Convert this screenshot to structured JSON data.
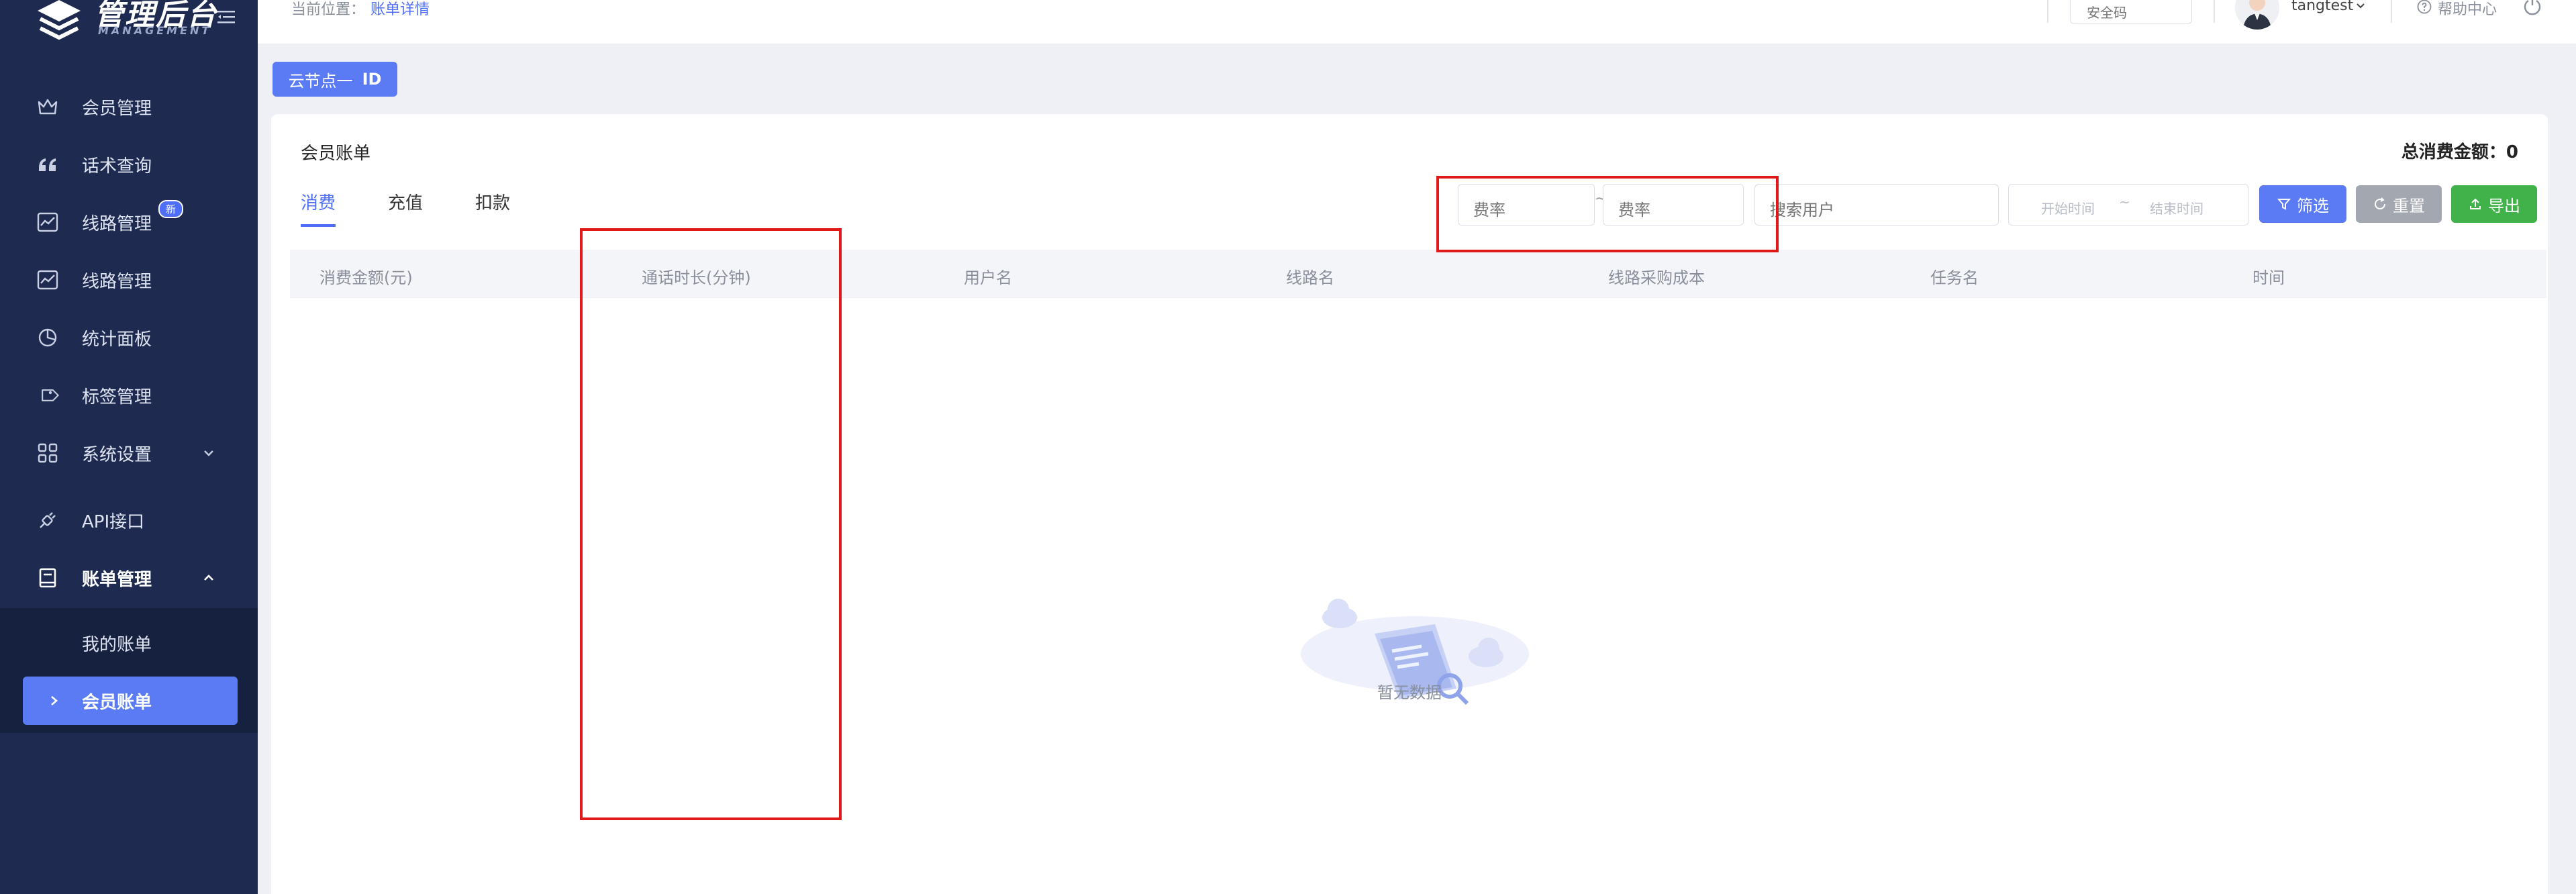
{
  "sidebar": {
    "logo_title": "管理后台",
    "logo_subtitle": "MANAGEMENT",
    "menu": [
      {
        "label": "会员管理",
        "icon": "crown-icon"
      },
      {
        "label": "话术查询",
        "icon": "quote-icon"
      },
      {
        "label": "线路管理",
        "icon": "line-chart-icon",
        "badge": "新"
      },
      {
        "label": "线路管理",
        "icon": "line-chart-icon"
      },
      {
        "label": "统计面板",
        "icon": "pie-chart-icon"
      },
      {
        "label": "标签管理",
        "icon": "tag-icon"
      },
      {
        "label": "系统设置",
        "icon": "grid-icon"
      },
      {
        "label": "API接口",
        "icon": "plug-icon"
      },
      {
        "label": "账单管理",
        "icon": "book-icon"
      }
    ],
    "submenu": [
      {
        "label": "我的账单"
      },
      {
        "label": "会员账单",
        "active": true
      }
    ]
  },
  "header": {
    "breadcrumb_prefix": "当前位置：",
    "breadcrumb_current": "账单详情",
    "security_placeholder": "安全码",
    "username": "tangtest",
    "help_label": "帮助中心"
  },
  "node": {
    "label": "云节点一",
    "id": "ID"
  },
  "panel": {
    "title": "会员账单",
    "total_label": "总消费金额：",
    "total_value": "0",
    "tabs": [
      "消费",
      "充值",
      "扣款"
    ],
    "active_tab": "消费"
  },
  "filters": {
    "rate_min_placeholder": "费率",
    "rate_max_placeholder": "费率",
    "range_sep": "~",
    "search_user_placeholder": "搜索用户",
    "start_time_placeholder": "开始时间",
    "end_time_placeholder": "结束时间",
    "filter_label": "筛选",
    "reset_label": "重置",
    "export_label": "导出"
  },
  "table": {
    "columns": [
      "消费金额(元)",
      "通话时长(分钟)",
      "用户名",
      "线路名",
      "线路采购成本",
      "任务名",
      "时间"
    ],
    "rows": [],
    "empty_text": "暂无数据"
  },
  "colors": {
    "sidebar_bg": "#1e2a4f",
    "accent": "#5b7bf5",
    "export_green": "#41b249",
    "annotation_red": "#e01818"
  }
}
